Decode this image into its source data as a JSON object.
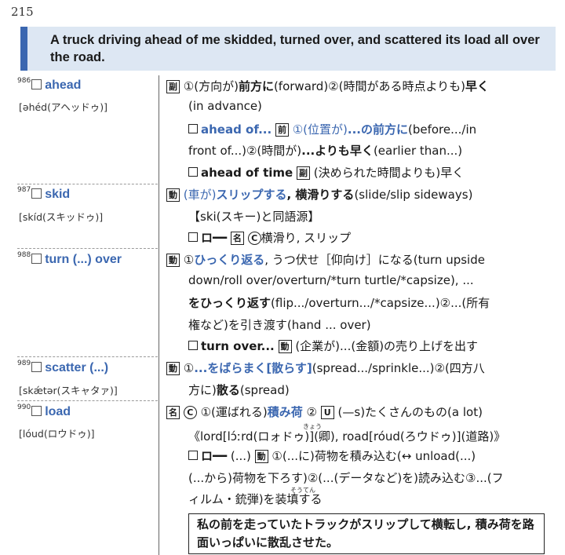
{
  "page_number": "215",
  "headline": "A truck driving ahead of me skidded, turned over, and scattered its load all over the road.",
  "entries": [
    {
      "num": "986",
      "word": "ahead",
      "pron": "[əhéd(アヘッドゥ)]"
    },
    {
      "num": "987",
      "word": "skid",
      "pron": "[skíd(スキッドゥ)]"
    },
    {
      "num": "988",
      "word": "turn (...) over",
      "pron": ""
    },
    {
      "num": "989",
      "word": "scatter (...)",
      "pron": "[skǽtər(スキャタァ)]"
    },
    {
      "num": "990",
      "word": "load",
      "pron": "[lóud(ロウドゥ)]"
    }
  ],
  "ahead": {
    "pos": "副",
    "l1a": "①(方向が)",
    "l1b": "前方に",
    "l1c": "(forward)②(時間がある時点よりも)",
    "l1d": "早く",
    "l2": "(in advance)",
    "p1_word": "ahead of...",
    "p1_pos": "前",
    "p1_a": "①(位置が)",
    "p1_b": "...の前方に",
    "p1_c": "(before.../in",
    "l4a": "front of...)②(時間が)",
    "l4b": "...よりも早く",
    "l4c": "(earlier than...)",
    "p2_word": "ahead of time",
    "p2_pos": "副",
    "p2_def": "(決められた時間よりも)早く"
  },
  "skid": {
    "pos": "動",
    "l1a": "(車が)",
    "l1b": "スリップする",
    "l1c": ", 横滑りする",
    "l1d": "(slide/slip sideways)",
    "l2": "【ski(スキー)と同語源】",
    "p1_word": "ロ━━",
    "p1_pos": "名",
    "p1_c": "C",
    "p1_def": "横滑り, スリップ"
  },
  "turnover": {
    "pos": "動",
    "l1a": "①",
    "l1b": "ひっくり返る",
    "l1c": ", うつ伏せ［仰向け］になる(turn upside",
    "l2": "down/roll over/overturn/*turn turtle/*capsize), ...",
    "l3a": "をひっくり返す",
    "l3b": "(flip.../overturn.../*capsize...)②...(所有",
    "l4": "権など)を引き渡す(hand ... over)",
    "p1_word": "turn over...",
    "p1_pos": "動",
    "p1_def": "(企業が)...(金額)の売り上げを出す"
  },
  "scatter": {
    "pos": "動",
    "l1a": "①",
    "l1b": "...をばらまく[散らす]",
    "l1c": "(spread.../sprinkle...)②(四方八",
    "l2a": "方に)",
    "l2b": "散る",
    "l2c": "(spread)"
  },
  "load": {
    "pos": "名",
    "c": "C",
    "l1a": "①(運ばれる)",
    "l1b": "積み荷",
    "l1c": "②",
    "l1u": "U",
    "l1d": "(—s)たくさんのもの(a lot)",
    "ruby1": "きょう",
    "l2": "《lord[lɔ́ːrd(ロォドゥ)](卿), road[róud(ろウドゥ)](道路)》",
    "p1_word": "ロ━━",
    "p1_a": "(...)",
    "p1_pos": "動",
    "p1_b": "①(...に)荷物を積み込む(↔ unload(...)",
    "l4": "(...から)荷物を下ろす)②(...(データなど)を)読み込む③...(フ",
    "ruby2": "そうてん",
    "l5": "ィルム・銃弾)を装填する"
  },
  "translation": "私の前を走っていたトラックがスリップして横転し, 積み荷を路面いっぱいに散乱させた。"
}
